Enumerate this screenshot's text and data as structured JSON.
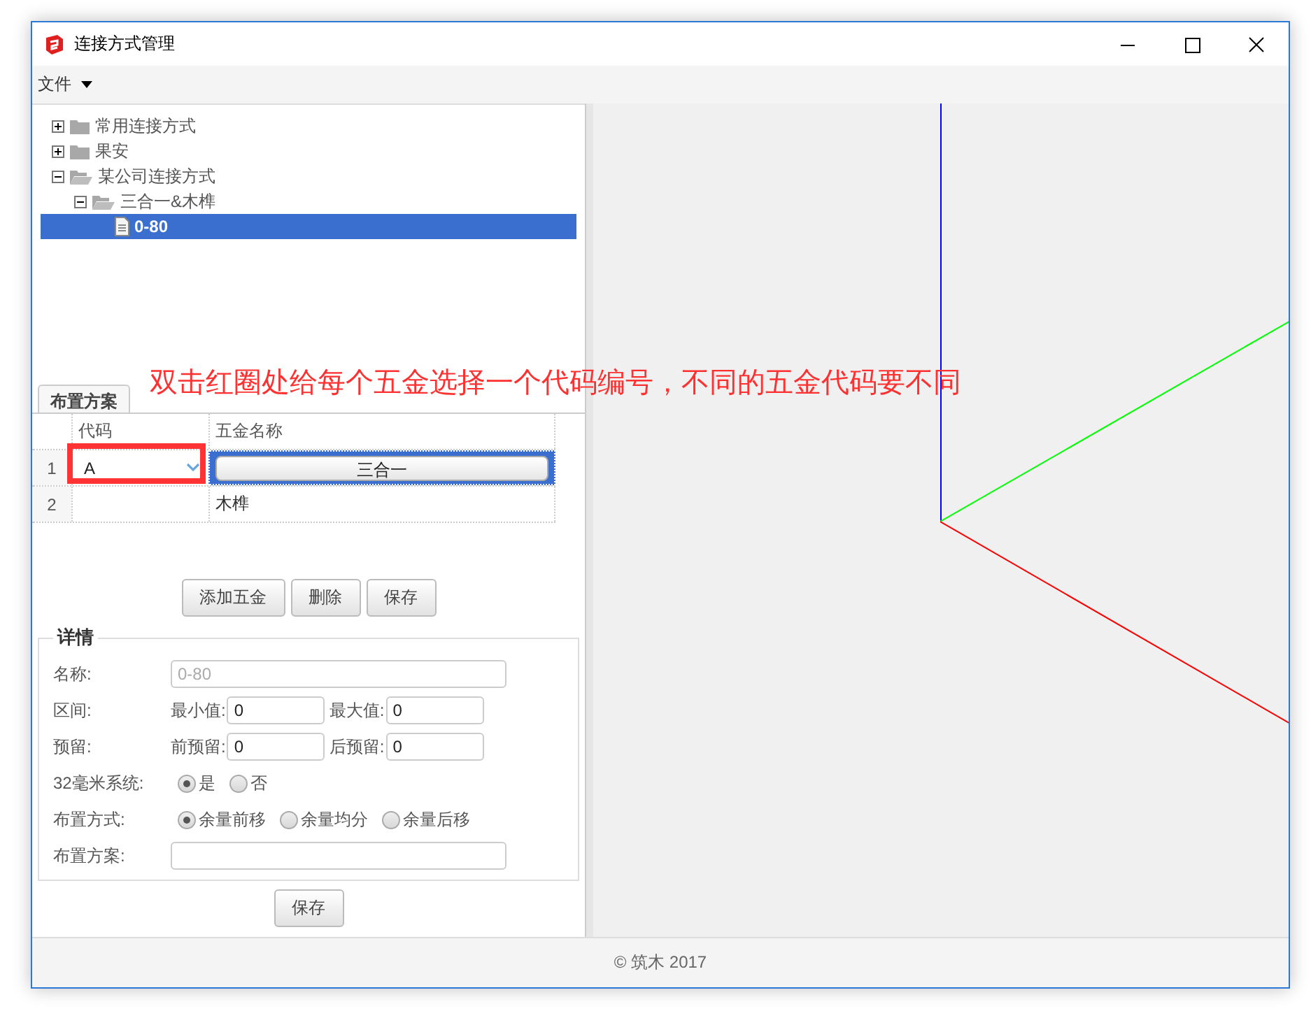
{
  "window": {
    "title": "连接方式管理"
  },
  "menu": [
    {
      "label": "文件"
    }
  ],
  "tree": [
    {
      "label": "常用连接方式",
      "kind": "folder",
      "expanded": false,
      "selected": false
    },
    {
      "label": "果安",
      "kind": "folder",
      "expanded": false,
      "selected": false
    },
    {
      "label": "某公司连接方式",
      "kind": "folder",
      "expanded": true,
      "selected": false,
      "children": [
        {
          "label": "三合一&木榫",
          "kind": "folder",
          "expanded": true,
          "selected": false,
          "children": [
            {
              "label": "0-80",
              "kind": "file",
              "selected": true
            }
          ]
        }
      ]
    }
  ],
  "annotation": "双击红圈处给每个五金选择一个代码编号，不同的五金代码要不同",
  "tabs": [
    {
      "label": "布置方案",
      "selected": true
    }
  ],
  "table": {
    "columns": [
      "代码",
      "五金名称"
    ],
    "rows": [
      {
        "index": "1",
        "code": "A",
        "name": "三合一",
        "selected": true
      },
      {
        "index": "2",
        "name": "木榫",
        "selected": false
      }
    ]
  },
  "buttons": [
    "添加五金",
    "删除",
    "保存"
  ],
  "details": {
    "legend": "详情",
    "name": {
      "label": "名称:",
      "value": "0-80",
      "disabled": true
    },
    "range": {
      "label": "区间:",
      "min_label": "最小值:",
      "min": "0",
      "max_label": "最大值:",
      "max": "0"
    },
    "reserve": {
      "label": "预留:",
      "front_label": "前预留:",
      "front": "0",
      "back_label": "后预留:",
      "back": "0"
    },
    "system32": {
      "label": "32毫米系统:",
      "options": [
        {
          "label": "是",
          "selected": true
        },
        {
          "label": "否",
          "selected": false
        }
      ]
    },
    "layout_mode": {
      "label": "布置方式:",
      "options": [
        {
          "label": "余量前移",
          "selected": true
        },
        {
          "label": "余量均分",
          "selected": false
        },
        {
          "label": "余量后移",
          "selected": false
        }
      ]
    },
    "plan": {
      "label": "布置方案:"
    }
  },
  "save_button": "保存",
  "status_bar": "© 筑木 2017"
}
